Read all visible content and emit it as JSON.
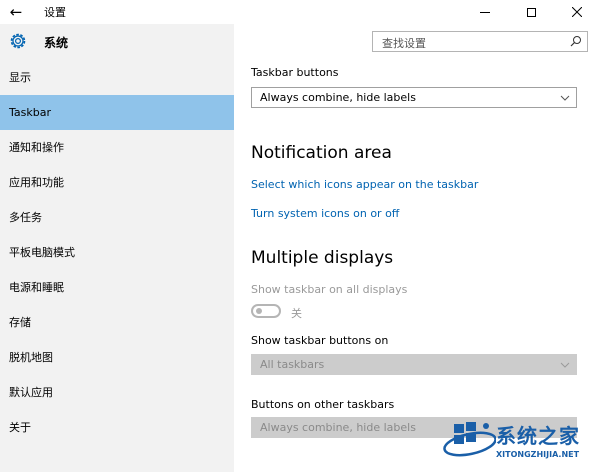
{
  "window": {
    "title": "设置",
    "back_icon": "←"
  },
  "sidebar": {
    "section_title": "系统",
    "section_icon": "gear-icon",
    "items": [
      {
        "label": "显示"
      },
      {
        "label": "Taskbar",
        "selected": true
      },
      {
        "label": "通知和操作"
      },
      {
        "label": "应用和功能"
      },
      {
        "label": "多任务"
      },
      {
        "label": "平板电脑模式"
      },
      {
        "label": "电源和睡眠"
      },
      {
        "label": "存储"
      },
      {
        "label": "脱机地图"
      },
      {
        "label": "默认应用"
      },
      {
        "label": "关于"
      }
    ],
    "selected_color": "#8fc3ea"
  },
  "search": {
    "placeholder": "查找设置"
  },
  "main": {
    "taskbar_buttons": {
      "label": "Taskbar buttons",
      "value": "Always combine, hide labels"
    },
    "notification_area": {
      "heading": "Notification area",
      "link_icons": "Select which icons appear on the taskbar",
      "link_system_icons": "Turn system icons on or off"
    },
    "multiple_displays": {
      "heading": "Multiple displays",
      "show_on_all_label": "Show taskbar on all displays",
      "toggle_state": "关",
      "toggle_on": false,
      "show_buttons_on_label": "Show taskbar buttons on",
      "show_buttons_on_value": "All taskbars",
      "other_taskbars_label": "Buttons on other taskbars",
      "other_taskbars_value": "Always combine, hide labels"
    },
    "link_color": "#0063b1"
  },
  "watermark": {
    "title": "系统之家",
    "url": "XITONGZHIJIA.NET"
  }
}
